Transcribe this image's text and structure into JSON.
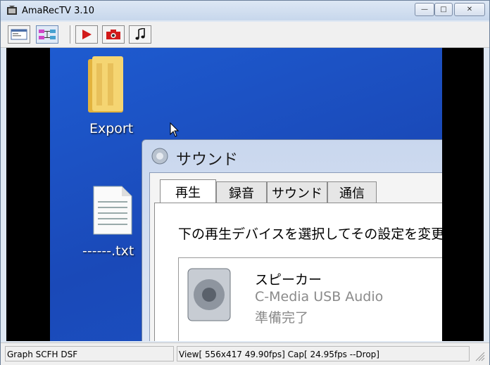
{
  "window": {
    "title": "AmaRecTV 3.10"
  },
  "titlebar_buttons": {
    "minimize": "—",
    "maximize": "□",
    "close": "✕"
  },
  "toolbar": {
    "buttons": [
      {
        "name": "view-window-button",
        "icon": "window-icon"
      },
      {
        "name": "graph-button",
        "icon": "graph-icon"
      },
      {
        "name": "record-button",
        "icon": "play-icon"
      },
      {
        "name": "snapshot-button",
        "icon": "camera-icon"
      },
      {
        "name": "audio-button",
        "icon": "music-note-icon"
      }
    ]
  },
  "preview": {
    "desktop_icons": [
      {
        "label": "Export"
      },
      {
        "label": "------.txt"
      }
    ],
    "dialog": {
      "title": "サウンド",
      "tabs": [
        "再生",
        "録音",
        "サウンド",
        "通信"
      ],
      "description": "下の再生デバイスを選択してその設定を変更し",
      "device": {
        "name": "スピーカー",
        "driver": "C-Media USB Audio",
        "status": "準備完了"
      }
    }
  },
  "status": {
    "left": "Graph SCFH DSF",
    "right": "View[ 556x417 49.90fps]  Cap[ 24.95fps --Drop]"
  },
  "colors": {
    "desktop": "#1a49b8",
    "record_red": "#d21b1b"
  }
}
